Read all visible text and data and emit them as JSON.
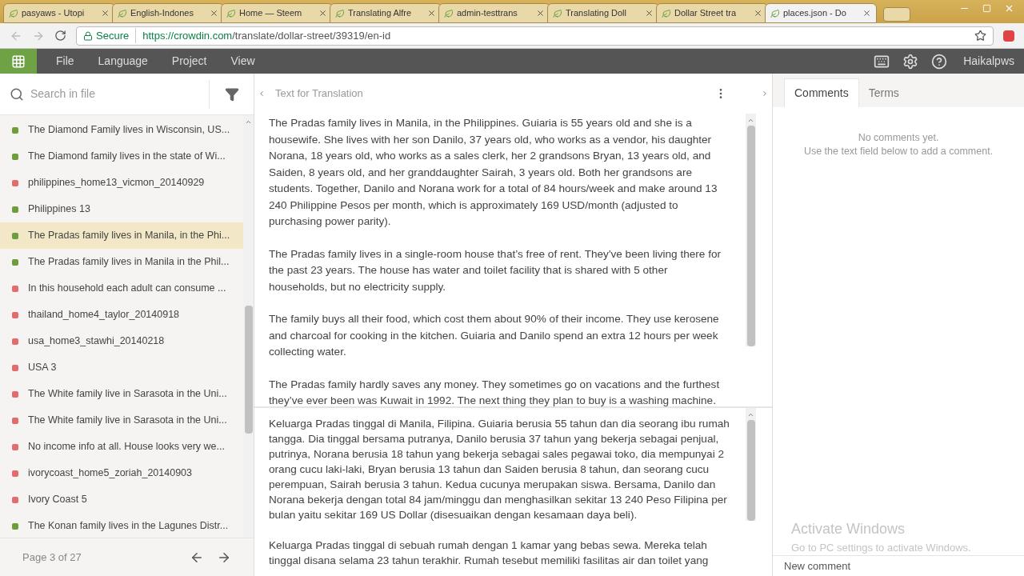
{
  "browser": {
    "tabs": [
      {
        "title": "pasyaws - Utopi",
        "selected": false
      },
      {
        "title": "English-Indones",
        "selected": false
      },
      {
        "title": "Home — Steem",
        "selected": false
      },
      {
        "title": "Translating Alfre",
        "selected": false
      },
      {
        "title": "admin-testtrans",
        "selected": false
      },
      {
        "title": "Translating Doll",
        "selected": false
      },
      {
        "title": "Dollar Street tra",
        "selected": false
      },
      {
        "title": "places.json - Do",
        "selected": true
      }
    ],
    "secure_label": "Secure",
    "url_host": "https://crowdin.com",
    "url_path": "/translate/dollar-street/39319/en-id"
  },
  "menu": {
    "items": [
      "File",
      "Language",
      "Project",
      "View"
    ],
    "user": "Haikalpws"
  },
  "sidebar": {
    "search": {
      "placeholder": "Search in file"
    },
    "items": [
      {
        "text": "The Diamond Family lives in Wisconsin, US...",
        "color": "#6c9e3c",
        "selected": false
      },
      {
        "text": "The Diamond family lives in the state of Wi...",
        "color": "#6c9e3c",
        "selected": false
      },
      {
        "text": "philippines_home13_vicmon_20140929",
        "color": "#e26b6b",
        "selected": false
      },
      {
        "text": "Philippines 13",
        "color": "#6c9e3c",
        "selected": false
      },
      {
        "text": "The Pradas family lives in Manila, in the Phi...",
        "color": "#6c9e3c",
        "selected": true
      },
      {
        "text": "The Pradas family lives in Manila in the Phil...",
        "color": "#6c9e3c",
        "selected": false
      },
      {
        "text": "In this household each adult can consume ...",
        "color": "#e26b6b",
        "selected": false
      },
      {
        "text": "thailand_home4_taylor_20140918",
        "color": "#e26b6b",
        "selected": false
      },
      {
        "text": "usa_home3_stawhi_20140218",
        "color": "#e26b6b",
        "selected": false
      },
      {
        "text": "USA 3",
        "color": "#e26b6b",
        "selected": false
      },
      {
        "text": "The White family live in Sarasota in the Uni...",
        "color": "#e26b6b",
        "selected": false
      },
      {
        "text": "The White family live in Sarasota in the Uni...",
        "color": "#e26b6b",
        "selected": false
      },
      {
        "text": "No income info at all. House looks very we...",
        "color": "#e26b6b",
        "selected": false
      },
      {
        "text": "ivorycoast_home5_zoriah_20140903",
        "color": "#e26b6b",
        "selected": false
      },
      {
        "text": "Ivory Coast 5",
        "color": "#e26b6b",
        "selected": false
      },
      {
        "text": "The Konan family lives in the Lagunes Distr...",
        "color": "#6c9e3c",
        "selected": false
      }
    ],
    "page": "Page 3 of 27"
  },
  "source": {
    "title": "Text for Translation",
    "paragraphs": [
      "The Pradas family lives in Manila, in the Philippines. Guiaria is 55 years old and she is a housewife. She lives with her son Danilo, 37 years old, who works as a vendor, his daughter Norana, 18 years old, who works as a sales clerk, her 2 grandsons Bryan, 13 years old, and Saiden, 8 years old, and her granddaughter Sairah, 3 years old. Both her grandsons are students. Together, Danilo and Norana work for a total of 84 hours/week and make around 13 240 Philippine Pesos per month, which is approximately 169 USD/month (adjusted to purchasing power parity).",
      "The Pradas family lives in a single-room house that’s free of rent. They've been living there for the past 23 years. The house has water and toilet facility that is shared with 5 other households, but no electricity supply.",
      "The family buys all their food, which cost them about 90% of their income. They use kerosene and charcoal for cooking in the kitchen. Guiaria and Danilo spend an extra 12 hours per week collecting water.",
      "The Pradas family hardly saves any money. They sometimes go on vacations and the furthest they’ve ever been was Kuwait in 1992. The next thing they plan to buy is a washing machine."
    ]
  },
  "translation": {
    "paragraphs": [
      "Keluarga Pradas tinggal di Manila, Filipina. Guiaria berusia 55 tahun dan dia seorang ibu rumah tangga. Dia tinggal bersama putranya, Danilo berusia 37 tahun yang bekerja sebagai penjual, putrinya, Norana berusia 18 tahun yang bekerja sebagai sales pegawai toko, dia mempunyai 2 orang cucu laki-laki, Bryan berusia 13 tahun dan Saiden berusia 8 tahun, dan seorang cucu perempuan, Sairah berusia 3 tahun. Kedua cucunya merupakan siswa. Bersama, Danilo dan Norana bekerja dengan total 84 jam/minggu dan menghasilkan sekitar 13 240 Peso Filipina per bulan yaitu sekitar 169 US Dollar (disesuaikan dengan kesamaan daya beli).",
      "Keluarga Pradas tinggal di sebuah rumah dengan 1 kamar yang bebas sewa. Mereka telah tinggal disana selama 23 tahun terakhir. Rumah tesebut memiliki fasilitas air dan toilet yang"
    ]
  },
  "comments": {
    "tabs": [
      {
        "label": "Comments",
        "selected": true
      },
      {
        "label": "Terms",
        "selected": false
      }
    ],
    "empty_title": "No comments yet.",
    "empty_hint": "Use the text field below to add a comment.",
    "activation_title": "Activate Windows",
    "activation_hint": "Go to PC settings to activate Windows.",
    "new_comment": {
      "placeholder": "New comment"
    }
  }
}
